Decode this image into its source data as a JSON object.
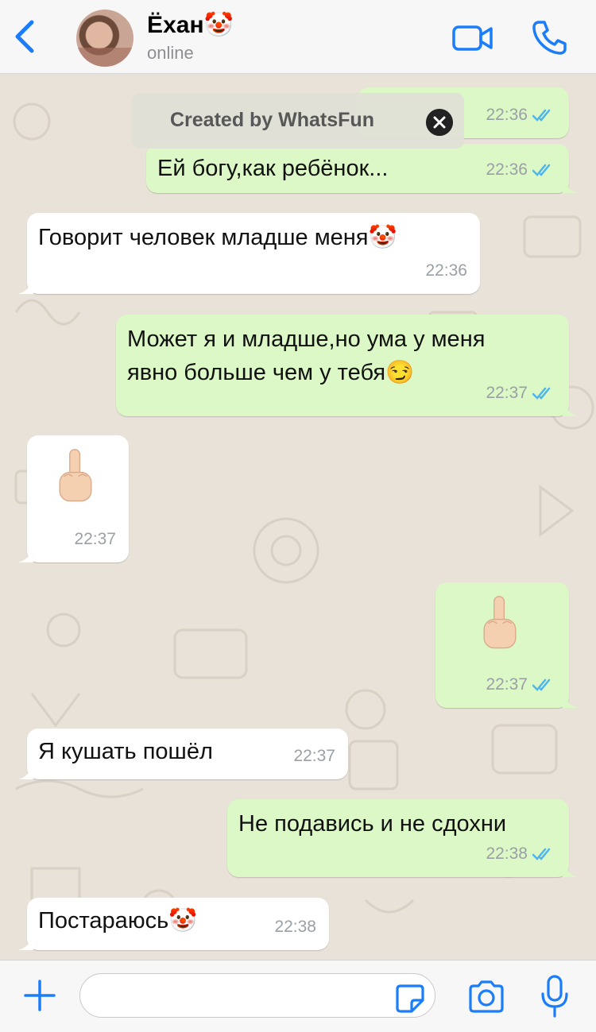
{
  "header": {
    "contact_name": "Ёхан🤡",
    "status": "online"
  },
  "banner": {
    "text": "Created by WhatsFun"
  },
  "messages": [
    {
      "direction": "out",
      "text": "",
      "time": "22:36",
      "read": true
    },
    {
      "direction": "out",
      "text": "Ей богу,как ребёнок...",
      "time": "22:36",
      "read": true
    },
    {
      "direction": "in",
      "text": "Говорит человек младше меня🤡",
      "time": "22:36"
    },
    {
      "direction": "out",
      "text_line1": "Может я и младше,но ума у меня",
      "text_line2": "явно больше чем у тебя😏",
      "time": "22:37",
      "read": true
    },
    {
      "direction": "in",
      "emoji": "middle-finger",
      "time": "22:37"
    },
    {
      "direction": "out",
      "emoji": "middle-finger",
      "time": "22:37",
      "read": true
    },
    {
      "direction": "in",
      "text": "Я кушать пошёл",
      "time": "22:37"
    },
    {
      "direction": "out",
      "text": "Не подавись и не сдохни",
      "time": "22:38",
      "read": true
    },
    {
      "direction": "in",
      "text": "Постараюсь🤡",
      "time": "22:38"
    }
  ],
  "composer": {
    "value": "",
    "placeholder": ""
  },
  "colors": {
    "accent": "#1a7dfa",
    "outgoing_bubble": "#dcf8c6",
    "incoming_bubble": "#ffffff",
    "read_ticks": "#4fb6ec",
    "background": "#e8e2d8"
  },
  "icons": [
    "back-chevron-icon",
    "video-call-icon",
    "phone-icon",
    "close-icon",
    "read-ticks-icon",
    "middle-finger-emoji",
    "plus-icon",
    "sticker-icon",
    "camera-icon",
    "microphone-icon"
  ]
}
